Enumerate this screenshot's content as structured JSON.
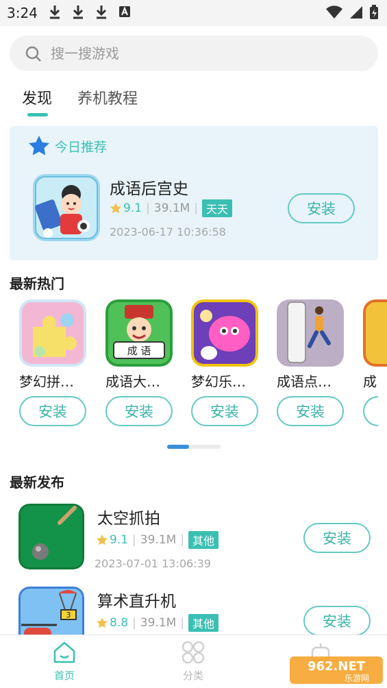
{
  "status_bar": {
    "time": "3:24",
    "icons": [
      "download-icon",
      "download-icon",
      "download-icon",
      "a-notification-icon",
      "wifi-icon",
      "signal-icon",
      "battery-icon"
    ]
  },
  "search": {
    "placeholder": "搜一搜游戏"
  },
  "tabs": [
    {
      "label": "发现",
      "active": true
    },
    {
      "label": "养机教程",
      "active": false
    }
  ],
  "recommend": {
    "header": "今日推荐",
    "app": {
      "name": "成语后宫史",
      "rating": "9.1",
      "size": "39.1M",
      "tag": "天天",
      "date": "2023-06-17 10:36:58",
      "install_label": "安装"
    }
  },
  "hot": {
    "title": "最新热门",
    "items": [
      {
        "name": "梦幻拼…",
        "install_label": "安装"
      },
      {
        "name": "成语大…",
        "install_label": "安装"
      },
      {
        "name": "梦幻乐…",
        "install_label": "安装"
      },
      {
        "name": "成语点…",
        "install_label": "安装"
      },
      {
        "name": "成",
        "install_label": ""
      }
    ]
  },
  "new_release": {
    "title": "最新发布",
    "items": [
      {
        "name": "太空抓拍",
        "rating": "9.1",
        "size": "39.1M",
        "tag": "其他",
        "date": "2023-07-01 13:06:39",
        "install_label": "安装"
      },
      {
        "name": "算术直升机",
        "rating": "8.8",
        "size": "39.1M",
        "tag": "其他",
        "date": "",
        "install_label": "安装"
      }
    ]
  },
  "bottom_nav": [
    {
      "label": "首页",
      "icon": "home-icon",
      "active": true
    },
    {
      "label": "分类",
      "icon": "category-icon",
      "active": false
    },
    {
      "label": "",
      "icon": "robot-icon",
      "active": false
    }
  ],
  "watermark": {
    "text": "962.NET",
    "subtext": "乐游网"
  },
  "colors": {
    "accent": "#3bbfb3",
    "card_bg": "#e8f4fa",
    "star": "#f2c14b",
    "pager": "#3b8fd9"
  }
}
